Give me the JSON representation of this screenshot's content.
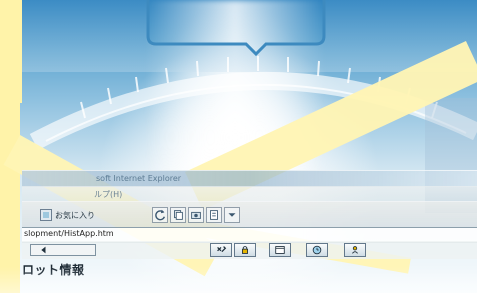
{
  "window": {
    "title": "soft Internet Explorer"
  },
  "menu": {
    "help_label": "ルプ(H)"
  },
  "toolbar": {
    "favorites_label": "お気に入り",
    "icons": [
      "refresh-icon",
      "copy-icon",
      "camera-icon",
      "page-icon",
      "dropdown-icon"
    ]
  },
  "address": {
    "value": "slopment/HistApp.htm"
  },
  "bottom_toolbar": {
    "icons": [
      "tools-icon",
      "lock-icon",
      "window-icon",
      "clock-icon",
      "person-icon"
    ]
  },
  "status": {
    "text": "ロット情報"
  },
  "colors": {
    "yellow": "#fff3a9",
    "blue": "#2f84c0",
    "cyan": "#94c4e1"
  }
}
